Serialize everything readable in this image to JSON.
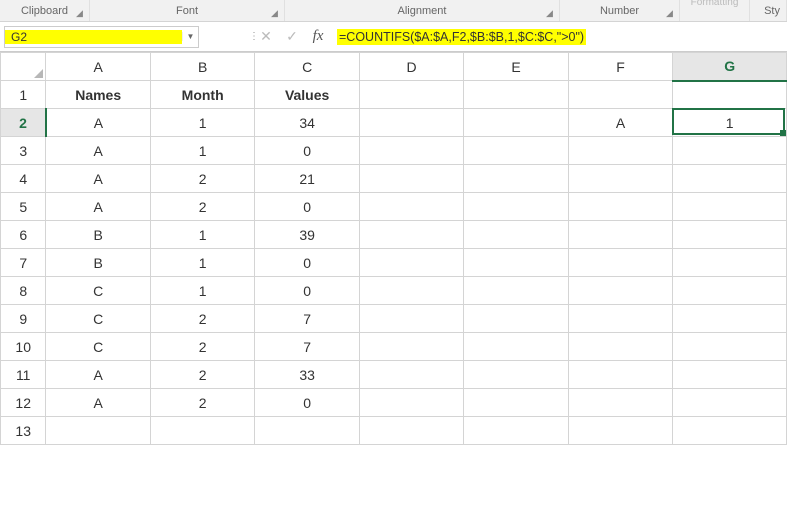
{
  "ribbon": {
    "groups": {
      "clipboard": "Clipboard",
      "font": "Font",
      "alignment": "Alignment",
      "number": "Number",
      "formatting": "Formatting",
      "sty": "Sty"
    }
  },
  "namebox": {
    "value": "G2"
  },
  "formula_bar": {
    "cancel": "✕",
    "enter": "✓",
    "fx": "fx",
    "formula": "=COUNTIFS($A:$A,F2,$B:$B,1,$C:$C,\">0\")"
  },
  "columns": [
    "A",
    "B",
    "C",
    "D",
    "E",
    "F",
    "G"
  ],
  "row_numbers": [
    "1",
    "2",
    "3",
    "4",
    "5",
    "6",
    "7",
    "8",
    "9",
    "10",
    "11",
    "12",
    "13"
  ],
  "headers": {
    "A": "Names",
    "B": "Month",
    "C": "Values"
  },
  "data": {
    "r2": {
      "A": "A",
      "B": "1",
      "C": "34",
      "F": "A",
      "G": "1"
    },
    "r3": {
      "A": "A",
      "B": "1",
      "C": "0"
    },
    "r4": {
      "A": "A",
      "B": "2",
      "C": "21"
    },
    "r5": {
      "A": "A",
      "B": "2",
      "C": "0"
    },
    "r6": {
      "A": "B",
      "B": "1",
      "C": "39"
    },
    "r7": {
      "A": "B",
      "B": "1",
      "C": "0"
    },
    "r8": {
      "A": "C",
      "B": "1",
      "C": "0"
    },
    "r9": {
      "A": "C",
      "B": "2",
      "C": "7"
    },
    "r10": {
      "A": "C",
      "B": "2",
      "C": "7"
    },
    "r11": {
      "A": "A",
      "B": "2",
      "C": "33"
    },
    "r12": {
      "A": "A",
      "B": "2",
      "C": "0"
    }
  },
  "active": {
    "col": "G",
    "row": "2"
  }
}
